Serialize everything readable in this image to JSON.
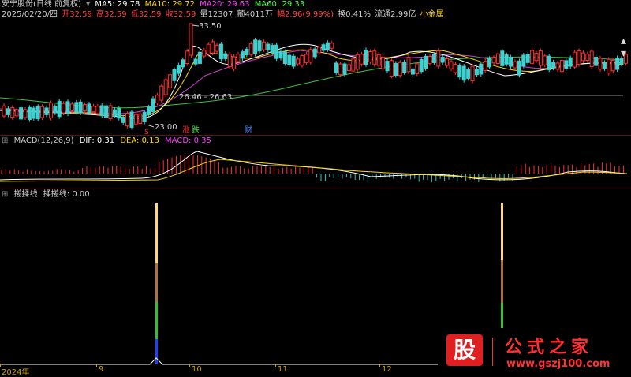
{
  "header": {
    "stock": "安宁股份(日线 前复权)",
    "ma": [
      {
        "label": "MA5: 29.78",
        "color": "#ffffff"
      },
      {
        "label": "MA10: 29.72",
        "color": "#ffd700"
      },
      {
        "label": "MA20: 29.63",
        "color": "#ff40ff"
      },
      {
        "label": "MA60: 29.33",
        "color": "#40ff40"
      }
    ],
    "quote": [
      {
        "label": "2025/02/20/四",
        "color": "#cccccc"
      },
      {
        "label": "开32.59",
        "color": "#ff4040"
      },
      {
        "label": "高32.59",
        "color": "#ff4040"
      },
      {
        "label": "低32.59",
        "color": "#ff4040"
      },
      {
        "label": "收32.59",
        "color": "#ff4040"
      },
      {
        "label": "量12307",
        "color": "#cccccc"
      },
      {
        "label": "额4011万",
        "color": "#cccccc"
      },
      {
        "label": "幅2.96(9.99%)",
        "color": "#ff4040"
      },
      {
        "label": "换0.41%",
        "color": "#cccccc"
      },
      {
        "label": "流通2.99亿",
        "color": "#cccccc"
      },
      {
        "label": "小金属",
        "color": "#ffd700"
      }
    ]
  },
  "price_chart": {
    "high_label": "33.50",
    "low_label": "23.00",
    "range_label": "26.46 - 26.63",
    "markers": [
      {
        "label": "S",
        "color": "#ff3030"
      },
      {
        "label": "涨",
        "color": "#ff3030"
      },
      {
        "label": "跌",
        "color": "#40d040"
      },
      {
        "label": "财",
        "color": "#4080ff"
      }
    ]
  },
  "macd": {
    "name": "MACD(12,26,9)",
    "dif": "DIF: 0.31",
    "dea": "DEA: 0.13",
    "macd": "MACD: 0.35",
    "colors": {
      "dif": "#ffffff",
      "dea": "#ffd700",
      "macd": "#ff40ff"
    }
  },
  "indicator": {
    "name": "搓揉线",
    "value": "揉搓线: 0.00"
  },
  "time_axis": [
    "2024年",
    "9",
    "10",
    "11",
    "12"
  ],
  "logo": {
    "char": "股",
    "title": "公式之家",
    "url": "www.gszj100.com"
  }
}
